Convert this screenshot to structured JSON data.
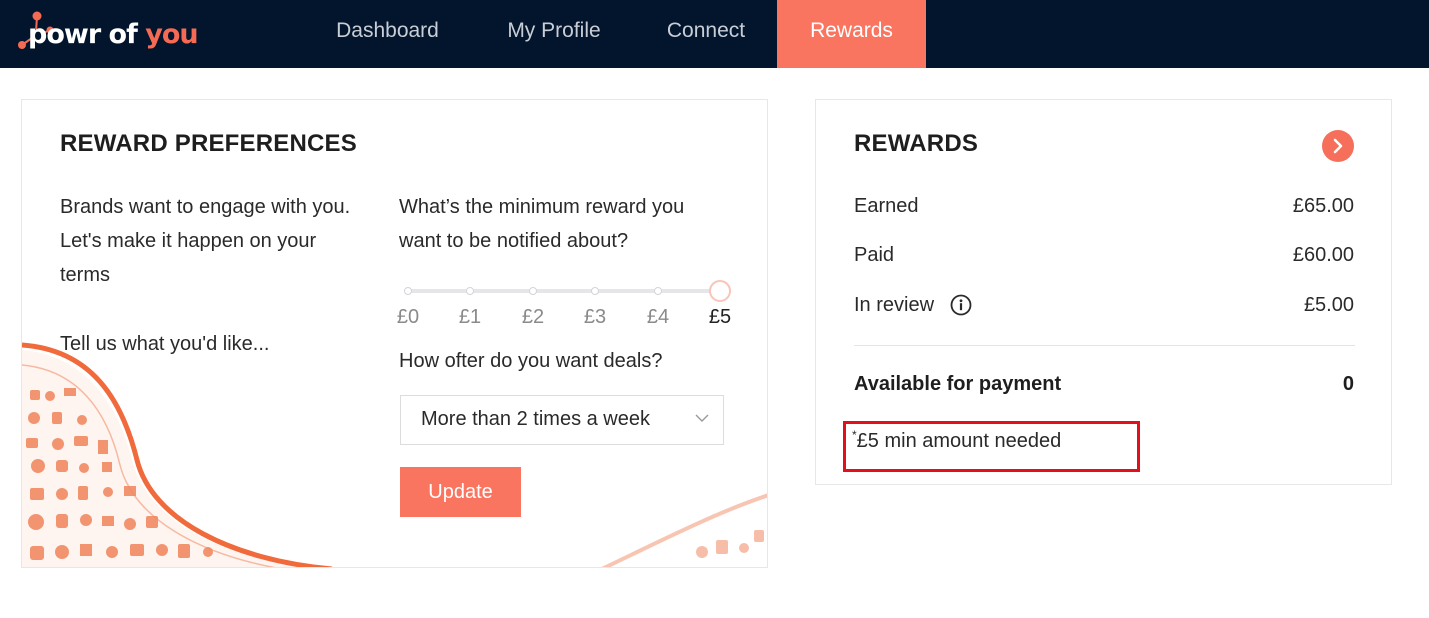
{
  "brand": {
    "logo_part1": "powr of ",
    "logo_part2": "you",
    "accent": "#fa7560",
    "navbar_bg": "#03152d"
  },
  "nav": {
    "items": [
      {
        "label": "Dashboard"
      },
      {
        "label": "My Profile"
      },
      {
        "label": "Connect"
      },
      {
        "label": "Rewards",
        "active": true
      }
    ]
  },
  "preferences": {
    "title": "REWARD PREFERENCES",
    "intro_line1": "Brands want to engage with you.",
    "intro_line2": "Let's make it happen on your",
    "intro_line3": "terms",
    "tell_us": "Tell us what you'd like...",
    "question1_line1": "What’s the minimum reward you",
    "question1_line2": "want to be notified about?",
    "slider_labels": [
      "£0",
      "£1",
      "£2",
      "£3",
      "£4",
      "£5"
    ],
    "slider_selected": "£5",
    "question2": "How ofter do you want deals?",
    "frequency_value": "More than 2 times a week",
    "update_label": "Update"
  },
  "rewards": {
    "title": "REWARDS",
    "earned_label": "Earned",
    "earned_value": "£65.00",
    "paid_label": "Paid",
    "paid_value": "£60.00",
    "review_label": "In review",
    "review_value": "£5.00",
    "available_label": "Available for payment",
    "available_value": "0",
    "note_star": "*",
    "note": "£5 min amount needed"
  }
}
